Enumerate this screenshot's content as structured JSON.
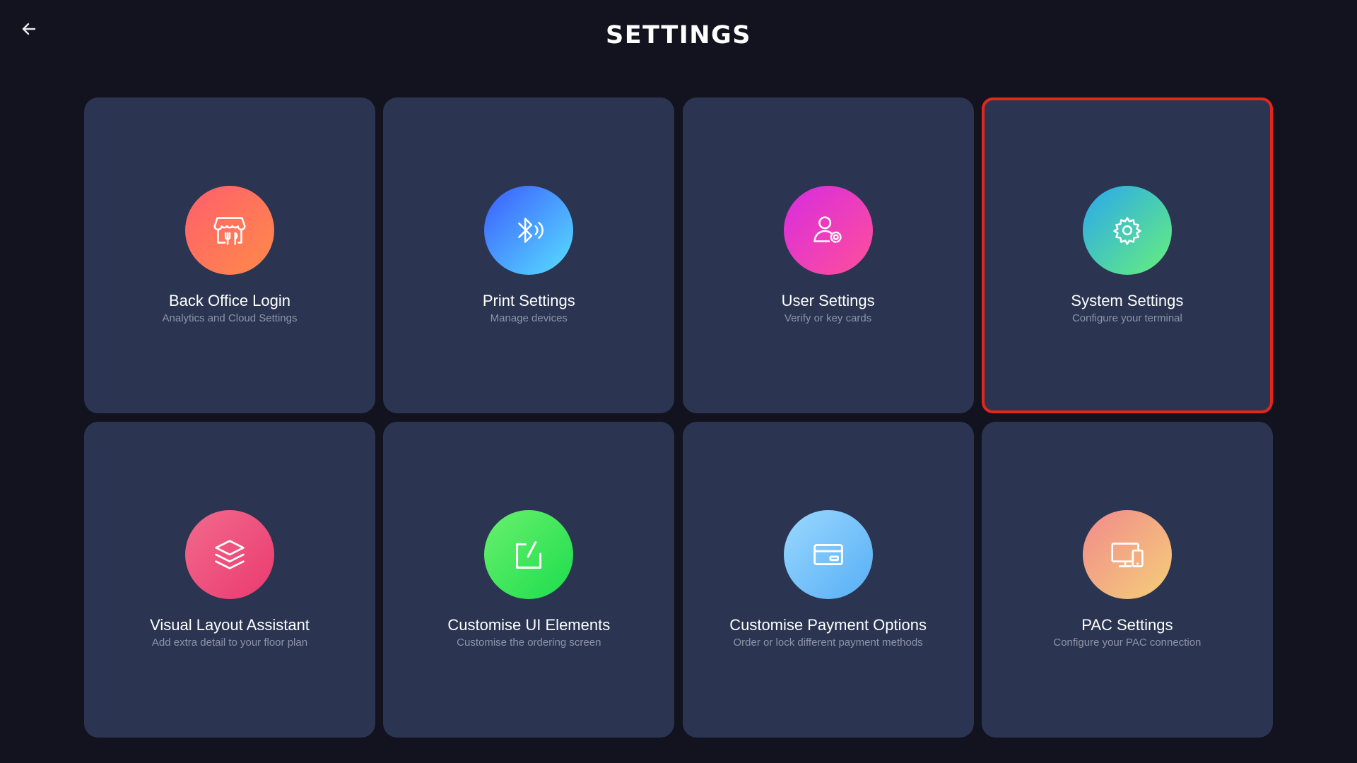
{
  "header": {
    "title": "SETTINGS",
    "back_icon": "arrow-left-icon"
  },
  "colors": {
    "background": "#12131f",
    "card": "#2b3551",
    "selected_border": "#e4261b",
    "subtitle": "#8d94a8"
  },
  "cards": [
    {
      "title": "Back Office Login",
      "subtitle": "Analytics and Cloud Settings",
      "icon": "storefront-icon",
      "selected": false
    },
    {
      "title": "Print Settings",
      "subtitle": "Manage devices",
      "icon": "bluetooth-icon",
      "selected": false
    },
    {
      "title": "User Settings",
      "subtitle": "Verify or key cards",
      "icon": "user-gear-icon",
      "selected": false
    },
    {
      "title": "System Settings",
      "subtitle": "Configure your terminal",
      "icon": "gear-icon",
      "selected": true
    },
    {
      "title": "Visual Layout Assistant",
      "subtitle": "Add extra detail to your floor plan",
      "icon": "layers-icon",
      "selected": false
    },
    {
      "title": "Customise UI Elements",
      "subtitle": "Customise the ordering screen",
      "icon": "edit-icon",
      "selected": false
    },
    {
      "title": "Customise Payment Options",
      "subtitle": "Order or lock different payment methods",
      "icon": "credit-card-icon",
      "selected": false
    },
    {
      "title": "PAC Settings",
      "subtitle": "Configure your PAC connection",
      "icon": "devices-icon",
      "selected": false
    }
  ]
}
